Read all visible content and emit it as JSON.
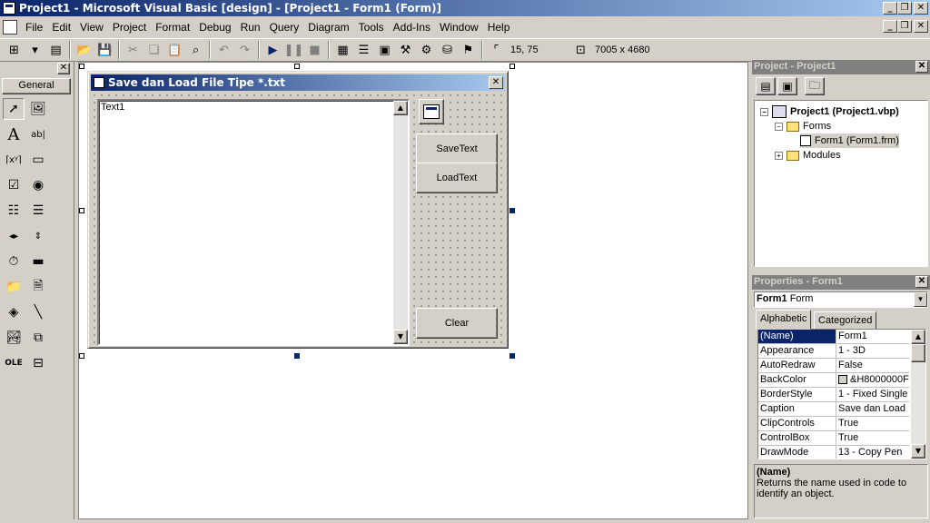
{
  "app": {
    "title": "Project1 - Microsoft Visual Basic [design] - [Project1 - Form1 (Form)]",
    "caption_buttons": [
      "_",
      "ђ",
      "X"
    ]
  },
  "menu": {
    "items": [
      "File",
      "Edit",
      "View",
      "Project",
      "Format",
      "Debug",
      "Run",
      "Query",
      "Diagram",
      "Tools",
      "Add-Ins",
      "Window",
      "Help"
    ]
  },
  "toolbar": {
    "position": "15, 75",
    "size": "7005 x 4680"
  },
  "toolbox": {
    "tab_label": "General",
    "tools": [
      "pointer",
      "picturebox",
      "label",
      "textbox",
      "frame",
      "commandbutton",
      "checkbox",
      "optionbutton",
      "combobox",
      "listbox",
      "hscrollbar",
      "vscrollbar",
      "timer",
      "drivelistbox",
      "dirlistbox",
      "filelistbox",
      "shape",
      "line",
      "image",
      "data",
      "ole",
      "extra"
    ]
  },
  "form": {
    "caption": "Save dan Load File Tipe *.txt",
    "textbox_text": "Text1",
    "buttons": {
      "save": "SaveText",
      "load": "LoadText",
      "clear": "Clear"
    }
  },
  "project": {
    "title": "Project - Project1",
    "tree": {
      "root": "Project1 (Project1.vbp)",
      "forms_folder": "Forms",
      "form1": "Form1 (Form1.frm)",
      "modules_folder": "Modules"
    }
  },
  "properties": {
    "title": "Properties - Form1",
    "object_name": "Form1",
    "object_type": "Form",
    "tabs": [
      "Alphabetic",
      "Categorized"
    ],
    "rows": [
      {
        "name": "(Name)",
        "value": "Form1"
      },
      {
        "name": "Appearance",
        "value": "1 - 3D"
      },
      {
        "name": "AutoRedraw",
        "value": "False"
      },
      {
        "name": "BackColor",
        "value": "&H8000000F"
      },
      {
        "name": "BorderStyle",
        "value": "1 - Fixed Single"
      },
      {
        "name": "Caption",
        "value": "Save dan Load F"
      },
      {
        "name": "ClipControls",
        "value": "True"
      },
      {
        "name": "ControlBox",
        "value": "True"
      },
      {
        "name": "DrawMode",
        "value": "13 - Copy Pen"
      }
    ],
    "desc_title": "(Name)",
    "desc_text": "Returns the name used in code to identify an object."
  }
}
